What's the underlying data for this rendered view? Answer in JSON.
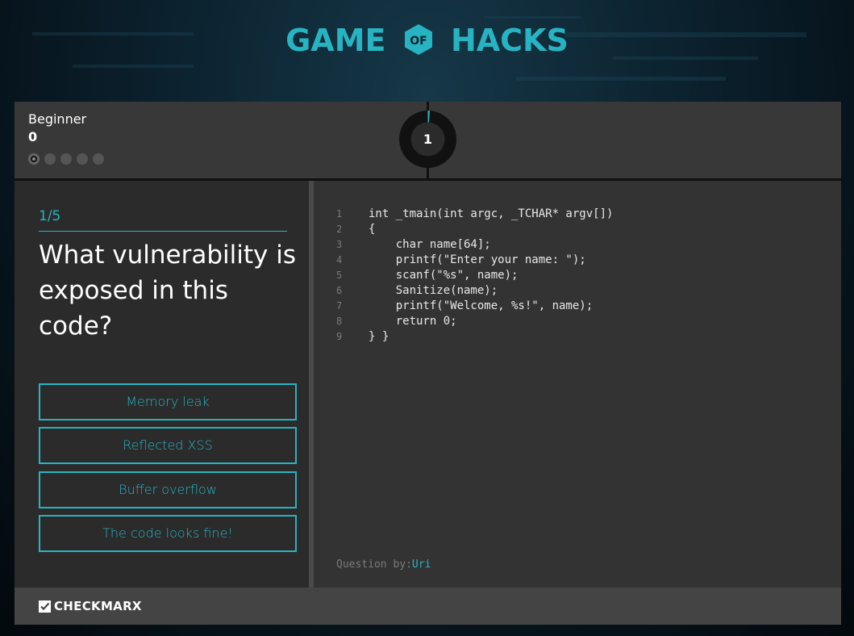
{
  "header": {
    "logo_left": "GAME",
    "logo_middle": "OF",
    "logo_right": "HACKS"
  },
  "status": {
    "level": "Beginner",
    "score": "0",
    "progress_total": 5,
    "progress_current": 1,
    "timer_value": "1"
  },
  "question": {
    "counter": "1/5",
    "text": "What vulnerability is exposed in this code?"
  },
  "answers": [
    "Memory leak",
    "Reflected XSS",
    "Buffer overflow",
    "The code looks fine!"
  ],
  "code": {
    "lines": [
      {
        "n": "1",
        "text": "int _tmain(int argc, _TCHAR* argv[])"
      },
      {
        "n": "2",
        "text": "{"
      },
      {
        "n": "3",
        "text": "    char name[64];"
      },
      {
        "n": "4",
        "text": "    printf(\"Enter your name: \");"
      },
      {
        "n": "5",
        "text": "    scanf(\"%s\", name);"
      },
      {
        "n": "6",
        "text": "    Sanitize(name);"
      },
      {
        "n": "7",
        "text": "    printf(\"Welcome, %s!\", name);"
      },
      {
        "n": "8",
        "text": "    return 0;"
      },
      {
        "n": "9",
        "text": "} }"
      }
    ]
  },
  "credit": {
    "prefix": "Question by:",
    "author": "Uri"
  },
  "footer": {
    "brand": "CHECKMARX"
  },
  "colors": {
    "accent": "#27b4c2",
    "panel": "#2b2b2b",
    "code_bg": "#333333"
  }
}
